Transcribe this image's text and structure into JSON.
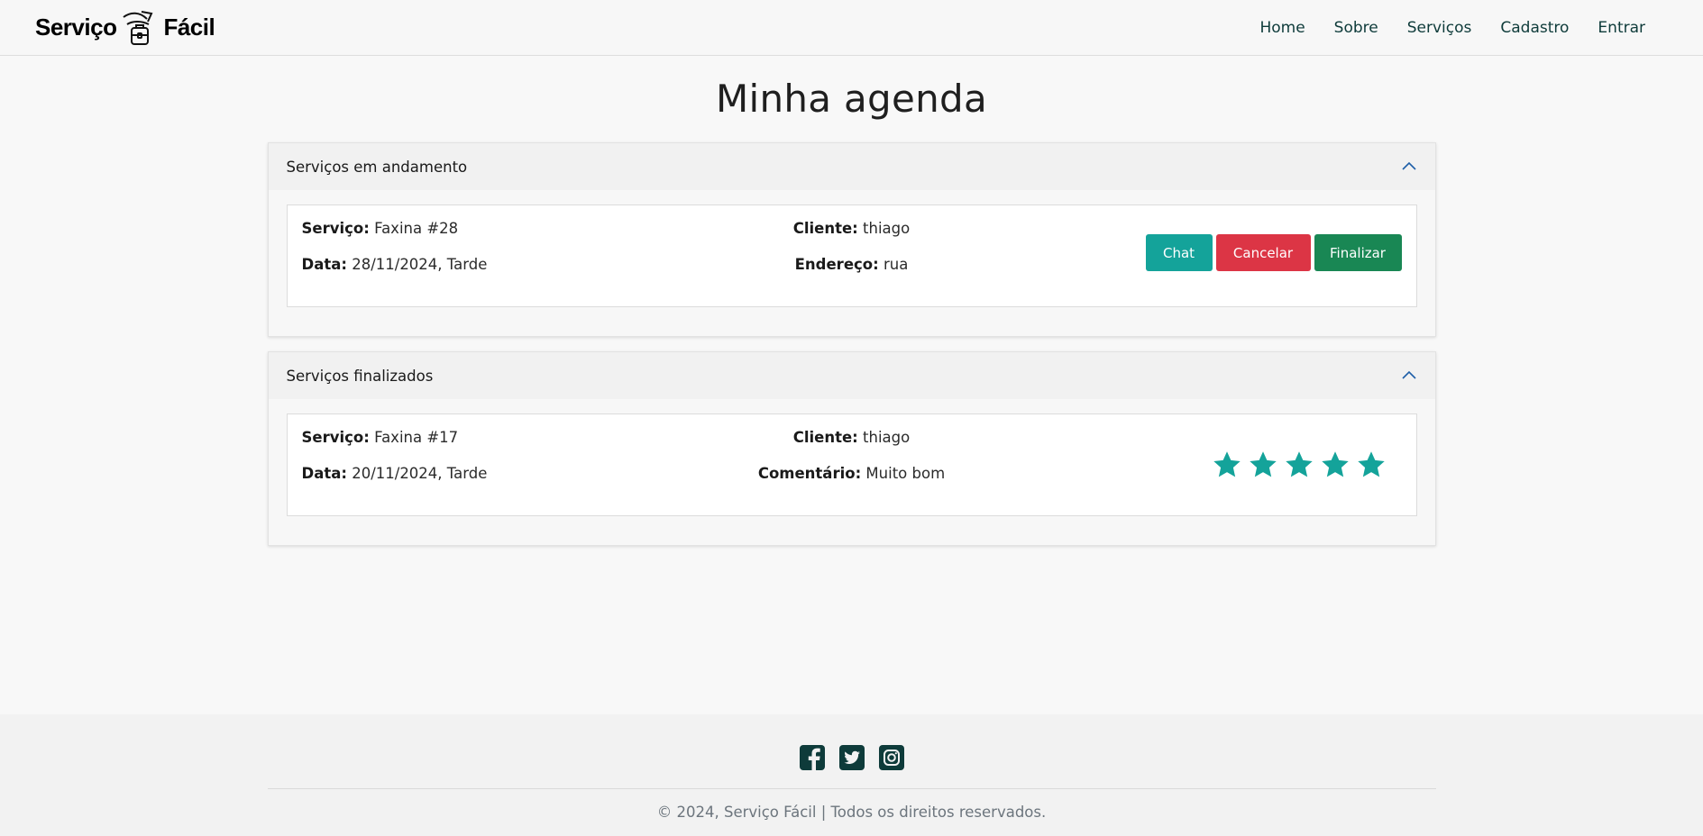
{
  "navbar": {
    "brand_left": "Serviço",
    "brand_right": "Fácil",
    "links": [
      "Home",
      "Sobre",
      "Serviços",
      "Cadastro",
      "Entrar"
    ]
  },
  "page": {
    "title": "Minha agenda"
  },
  "in_progress": {
    "header": "Serviços em andamento",
    "service_label": "Serviço:",
    "service_value": "Faxina #28",
    "date_label": "Data:",
    "date_value": "28/11/2024, Tarde",
    "client_label": "Cliente:",
    "client_value": "thiago",
    "address_label": "Endereço:",
    "address_value": "rua",
    "buttons": {
      "chat": "Chat",
      "cancel": "Cancelar",
      "finish": "Finalizar"
    }
  },
  "finished": {
    "header": "Serviços finalizados",
    "service_label": "Serviço:",
    "service_value": "Faxina #17",
    "date_label": "Data:",
    "date_value": "20/11/2024, Tarde",
    "client_label": "Cliente:",
    "client_value": "thiago",
    "comment_label": "Comentário:",
    "comment_value": "Muito bom",
    "rating": 5,
    "rating_max": 5
  },
  "footer": {
    "social": [
      "facebook-icon",
      "twitter-icon",
      "instagram-icon"
    ],
    "copyright": "© 2024, Serviço Fácil | Todos os direitos reservados."
  },
  "colors": {
    "accent": "#14a39a",
    "danger": "#dc3545",
    "success": "#198754",
    "nav_text": "#0e3b3a",
    "social": "#0e3b3a",
    "chevron": "#1f5fa8"
  }
}
